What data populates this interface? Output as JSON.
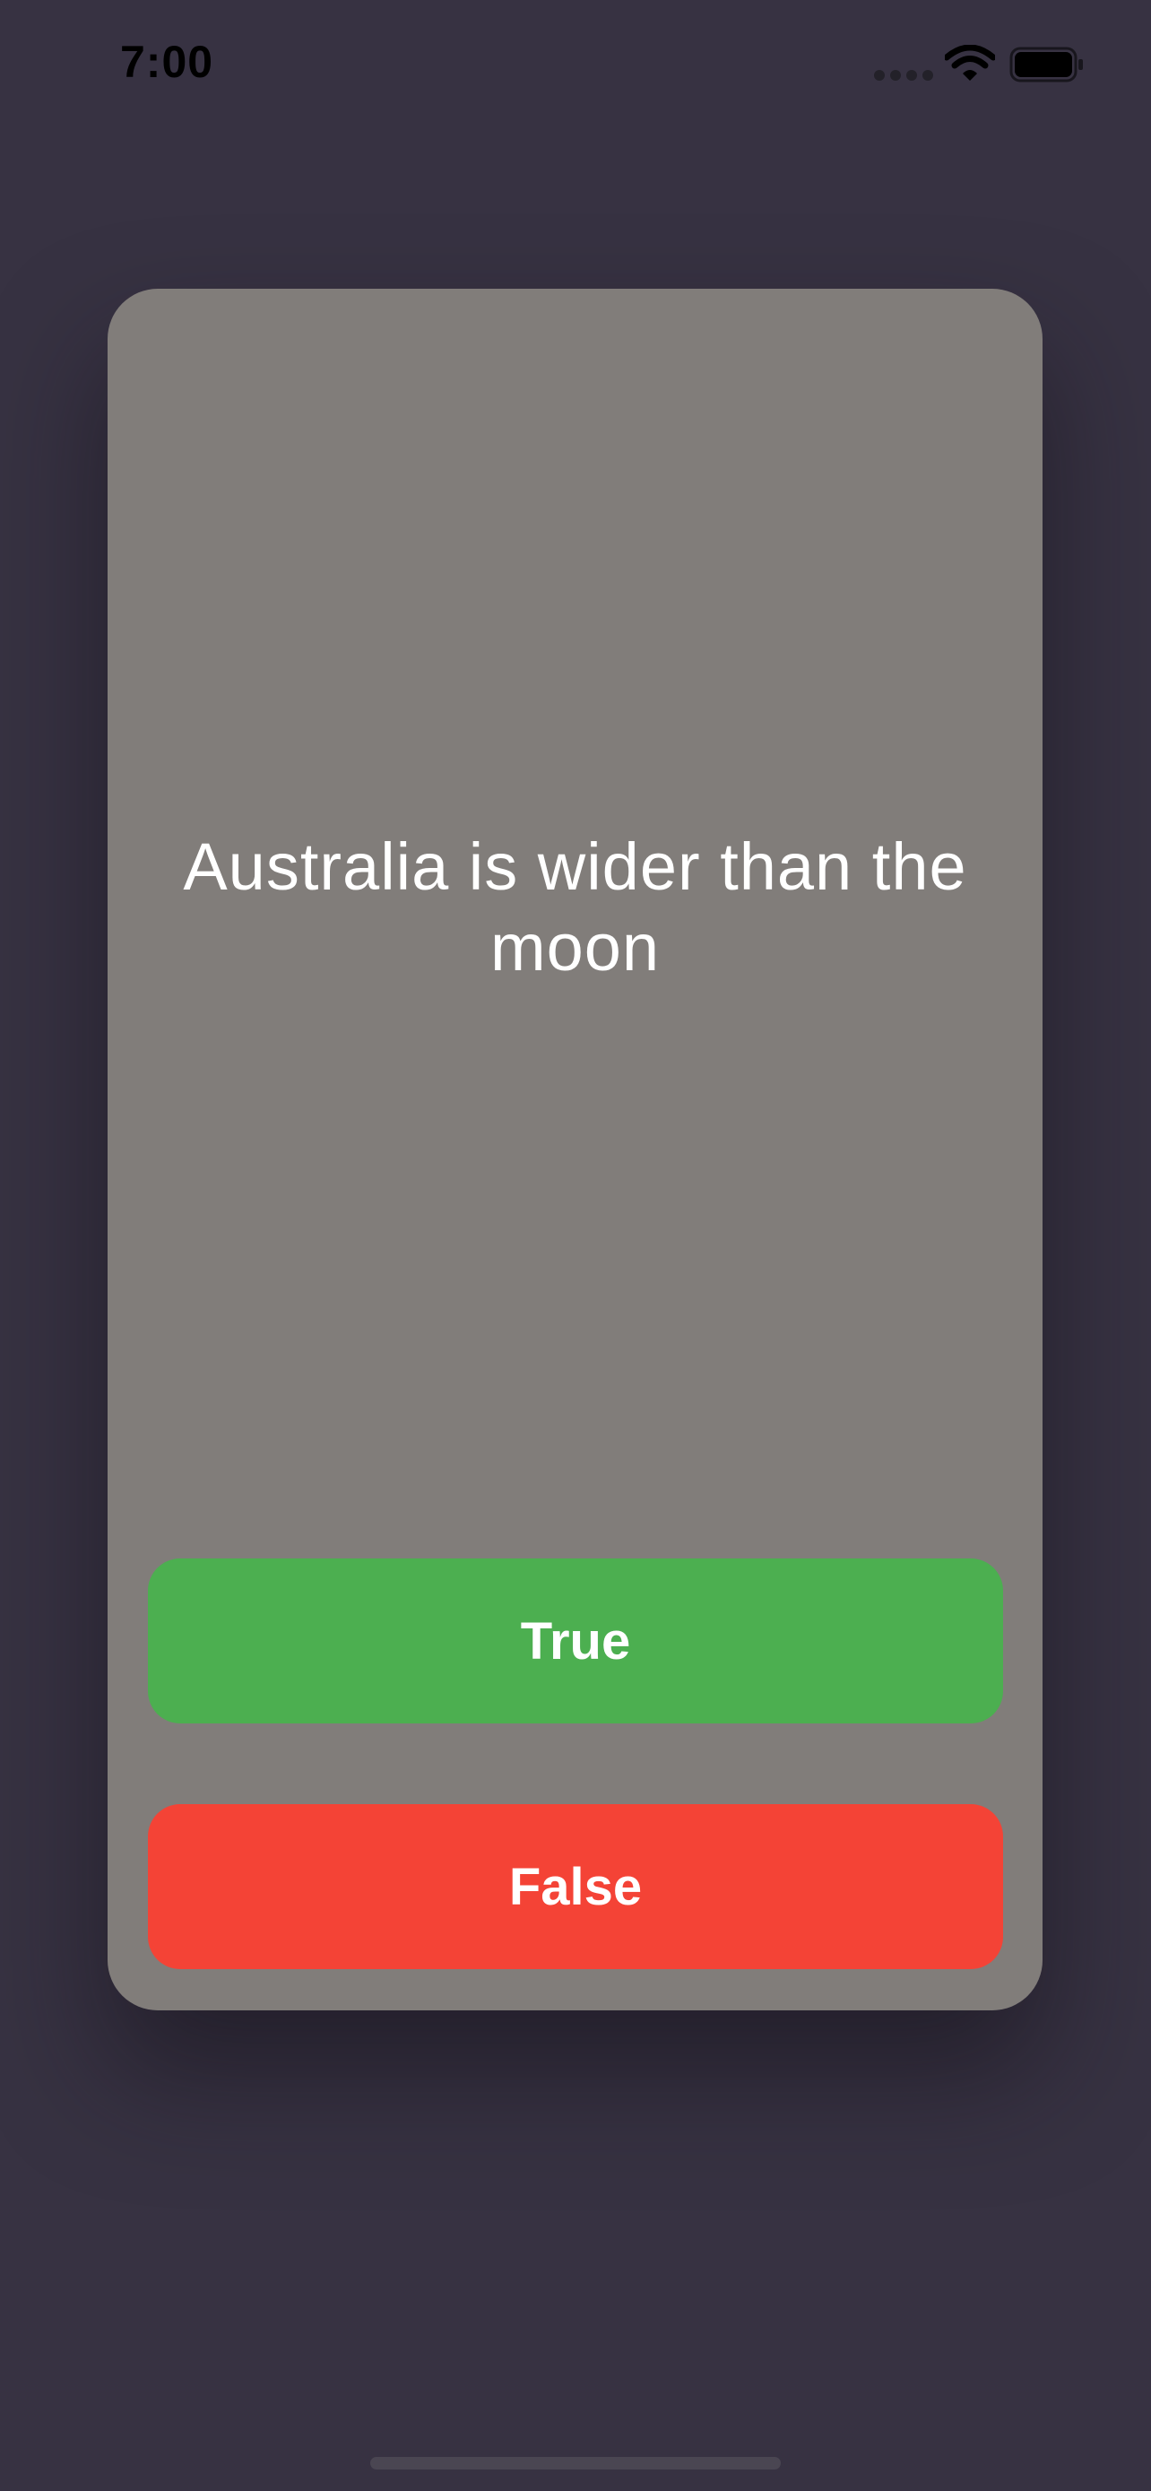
{
  "status_bar": {
    "time": "7:00",
    "icons": [
      "signal-icon",
      "wifi-icon",
      "battery-icon"
    ]
  },
  "quiz": {
    "question": "Australia is wider than the moon",
    "true_label": "True",
    "false_label": "False"
  },
  "colors": {
    "background": "#373242",
    "card": "#817d7a",
    "true_button": "#4caf50",
    "false_button": "#f44336",
    "text": "#ffffff"
  }
}
